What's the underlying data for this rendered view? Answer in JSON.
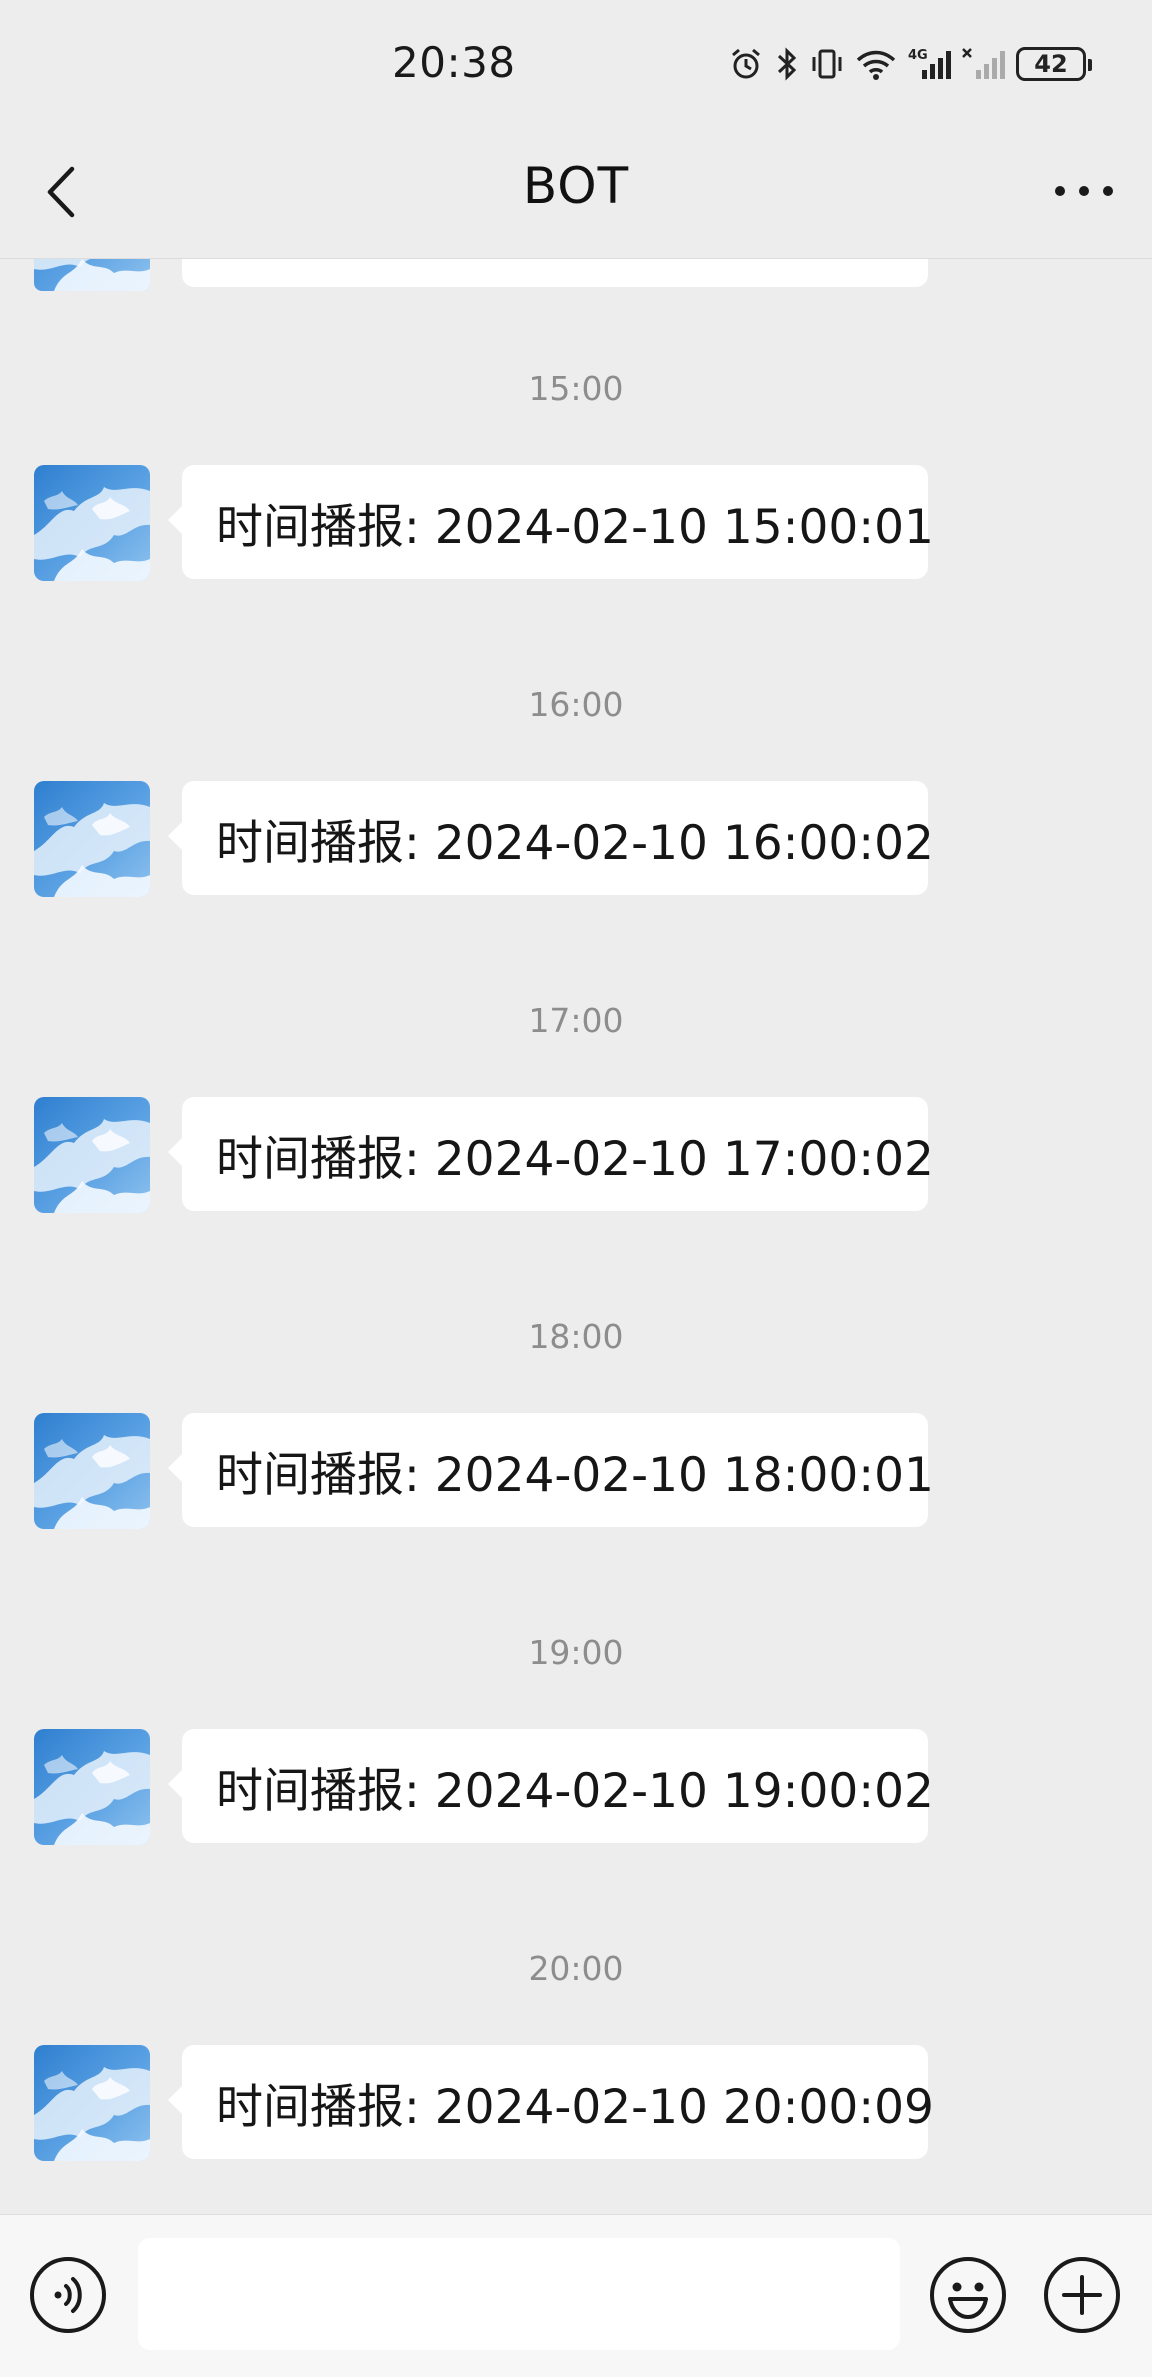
{
  "status_bar": {
    "time": "20:38",
    "battery": "42",
    "icons": [
      "alarm-icon",
      "bluetooth-icon",
      "vibrate-icon",
      "wifi-icon",
      "signal-4g-icon",
      "signal-no-service-icon",
      "battery-icon"
    ]
  },
  "nav": {
    "title": "BOT",
    "back_icon": "chevron-left-icon",
    "more_icon": "more-dots-icon"
  },
  "messages": [
    {
      "time": "15:00",
      "text": "时间播报: 2024-02-10 15:00:01"
    },
    {
      "time": "16:00",
      "text": "时间播报: 2024-02-10 16:00:02"
    },
    {
      "time": "17:00",
      "text": "时间播报: 2024-02-10 17:00:02"
    },
    {
      "time": "18:00",
      "text": "时间播报: 2024-02-10 18:00:01"
    },
    {
      "time": "19:00",
      "text": "时间播报: 2024-02-10 19:00:02"
    },
    {
      "time": "20:00",
      "text": "时间播报: 2024-02-10 20:00:09"
    }
  ],
  "input_bar": {
    "value": "",
    "voice_icon": "voice-input-icon",
    "emoji_icon": "emoji-icon",
    "plus_icon": "plus-icon"
  }
}
